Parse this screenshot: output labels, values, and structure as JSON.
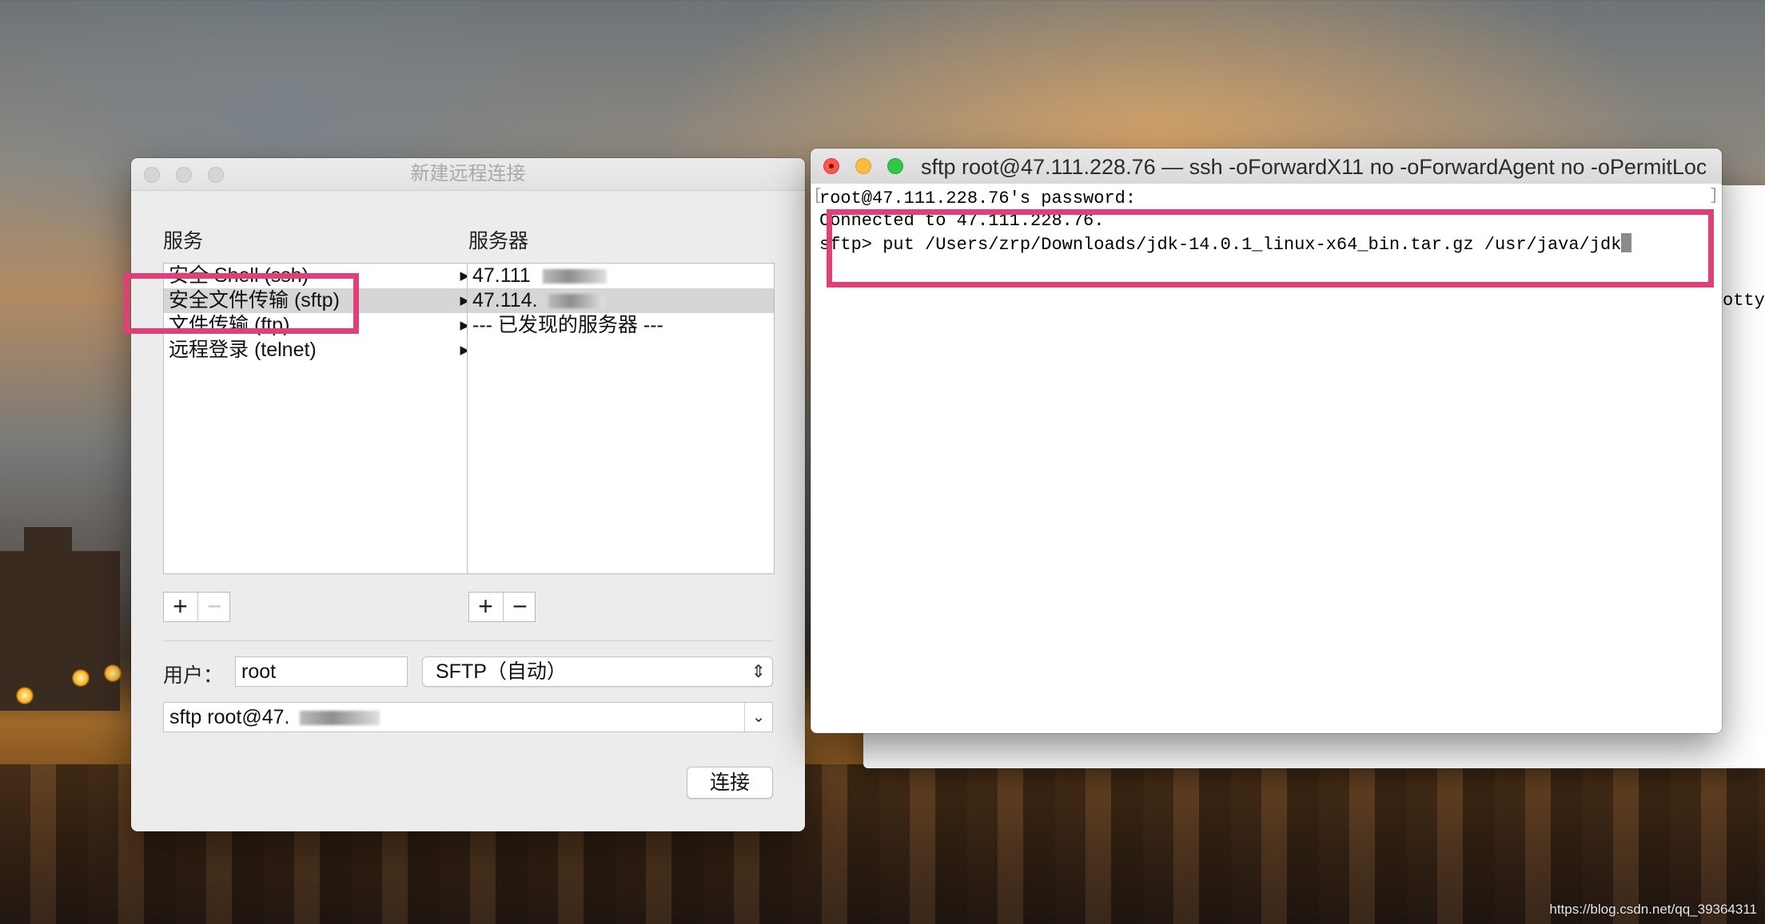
{
  "dialog": {
    "title": "新建远程连接",
    "services_header": "服务",
    "servers_header": "服务器",
    "services": [
      {
        "label": "安全 Shell (ssh)",
        "selected": false
      },
      {
        "label": "安全文件传输 (sftp)",
        "selected": true
      },
      {
        "label": "文件传输 (ftp)",
        "selected": false
      },
      {
        "label": "远程登录 (telnet)",
        "selected": false
      }
    ],
    "servers": [
      {
        "label": "47.111",
        "selected": false
      },
      {
        "label": "47.114.",
        "selected": true
      },
      {
        "label": "--- 已发现的服务器 ---",
        "selected": false
      }
    ],
    "plus_label": "+",
    "minus_label": "−",
    "user_label": "用户：",
    "user_value": "root",
    "protocol_select": "SFTP（自动）",
    "command_value": "sftp root@47.",
    "connect_button": "连接"
  },
  "terminal": {
    "title": "sftp root@47.111.228.76 — ssh -oForwardX11 no -oForwardAgent no -oPermitLoc...",
    "lines": [
      "root@47.111.228.76's password:",
      "Connected to 47.111.228.76.",
      "sftp> put /Users/zrp/Downloads/jdk-14.0.1_linux-x64_bin.tar.gz /usr/java/jdk"
    ]
  },
  "background_terminal": {
    "fragment": "otty"
  },
  "watermark": "https://blog.csdn.net/qq_39364311",
  "colors": {
    "highlight": "#e0407a",
    "close": "#fc5753",
    "minimize": "#fdbc40",
    "zoom": "#33c748"
  }
}
